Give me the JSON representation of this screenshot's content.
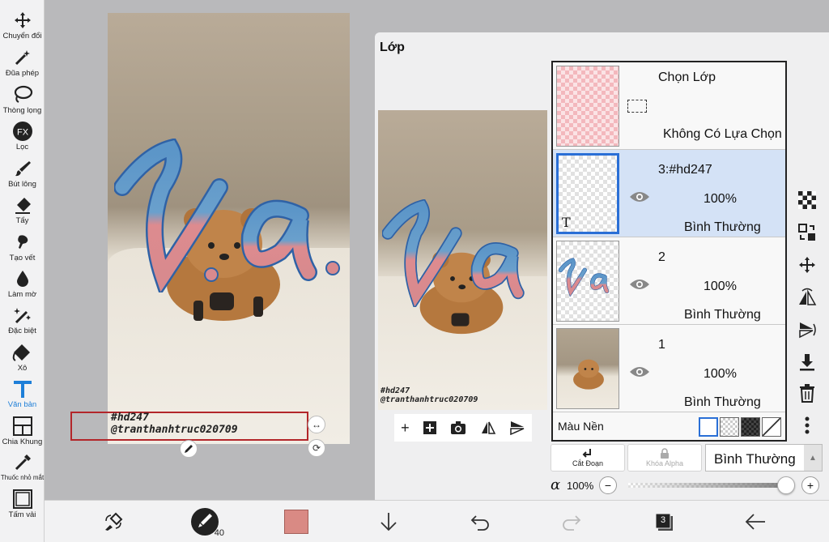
{
  "toolbar": {
    "tools": [
      {
        "label": "Chuyển đổi",
        "icon": "move-icon"
      },
      {
        "label": "Đũa phép",
        "icon": "magic-wand-icon"
      },
      {
        "label": "Thòng lọng",
        "icon": "lasso-icon"
      },
      {
        "label": "Lọc",
        "icon": "fx-filter-icon"
      },
      {
        "label": "Bút lông",
        "icon": "brush-icon"
      },
      {
        "label": "Tẩy",
        "icon": "eraser-icon"
      },
      {
        "label": "Tạo vết",
        "icon": "smudge-icon"
      },
      {
        "label": "Làm mờ",
        "icon": "blur-drop-icon"
      },
      {
        "label": "Đặc biệt",
        "icon": "special-brush-icon"
      },
      {
        "label": "Xô",
        "icon": "bucket-icon"
      },
      {
        "label": "Văn bản",
        "icon": "text-icon",
        "active": true
      },
      {
        "label": "Chia Khung",
        "icon": "frame-divider-icon"
      },
      {
        "label": "Thuốc nhỏ mắt",
        "icon": "eyedropper-icon"
      },
      {
        "label": "Tấm vải",
        "icon": "canvas-icon"
      }
    ],
    "active_color": "#1e7fd8"
  },
  "canvas": {
    "watermark_line1": "#hd247",
    "watermark_line2": "@tranthanhtruc020709",
    "art_text": "v.a."
  },
  "layer_panel": {
    "title": "Lớp",
    "selection_layer": {
      "title": "Chọn Lớp",
      "status": "Không Có Lựa Chọn"
    },
    "layers": [
      {
        "name": "3:#hd247",
        "opacity": "100%",
        "blend": "Bình Thường",
        "selected": true,
        "thumb_badge": "T"
      },
      {
        "name": "2",
        "opacity": "100%",
        "blend": "Bình Thường",
        "selected": false
      },
      {
        "name": "1",
        "opacity": "100%",
        "blend": "Bình Thường",
        "selected": false
      }
    ],
    "background_label": "Màu Nền",
    "clip_label": "Cắt Đoạn",
    "alpha_lock_label": "Khóa Alpha",
    "blend_mode": "Bình Thường",
    "alpha_symbol": "α",
    "alpha_value": "100%",
    "layer_count": "3",
    "brush_size": "40",
    "current_color": "#d98a84",
    "selection_color": "#2a6fd6"
  }
}
